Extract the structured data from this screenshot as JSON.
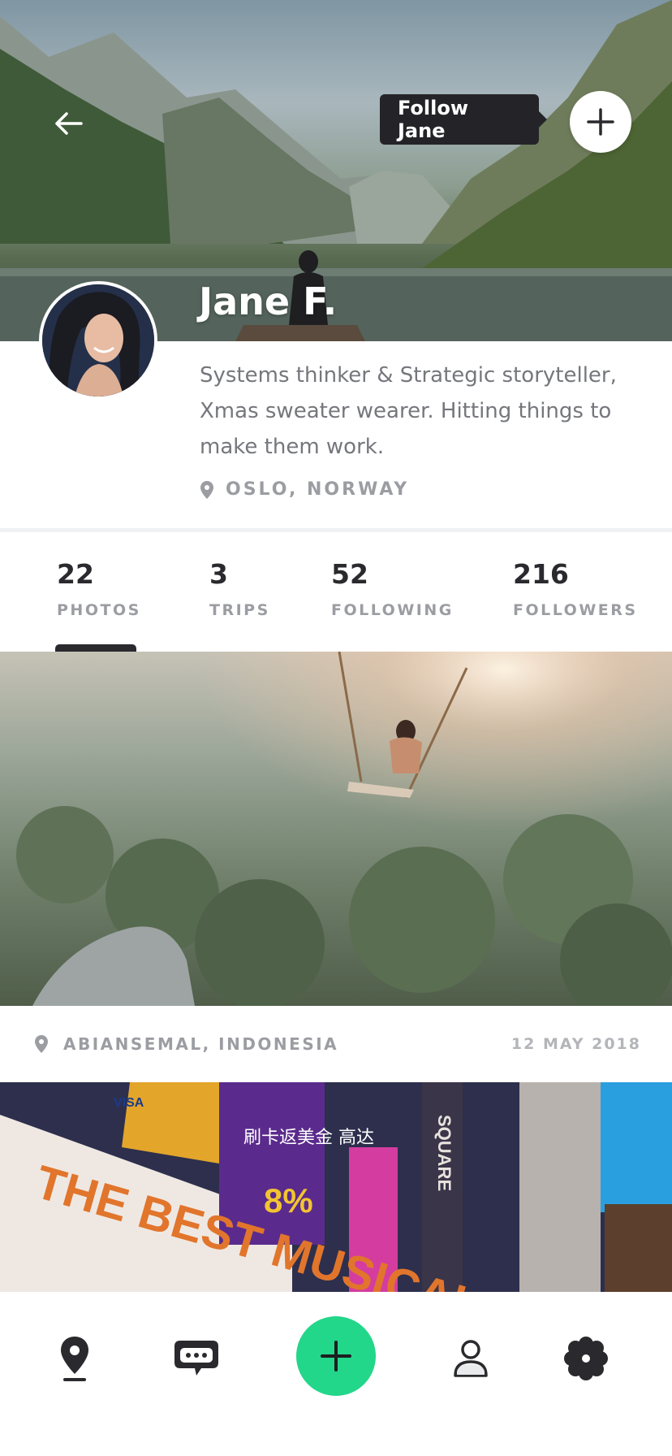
{
  "header": {
    "follow_tooltip": "Follow Jane",
    "back_icon": "arrow-left-icon",
    "follow_icon": "plus-icon"
  },
  "profile": {
    "name": "Jane F.",
    "bio": "Systems thinker & Strategic storyteller, Xmas sweater wearer. Hitting things to make them work.",
    "location": "OSLO, NORWAY"
  },
  "stats": [
    {
      "value": "22",
      "label": "PHOTOS"
    },
    {
      "value": "3",
      "label": "TRIPS"
    },
    {
      "value": "52",
      "label": "FOLLOWING"
    },
    {
      "value": "216",
      "label": "FOLLOWERS"
    }
  ],
  "active_stat": "PHOTOS",
  "feed": [
    {
      "location": "ABIANSEMAL, INDONESIA",
      "date": "12 MAY 2018"
    }
  ],
  "photo2_signs": {
    "billboard": "THE BEST MUSICAL OF THIS",
    "percent": "8%",
    "chinese": "刷卡返美金 高达",
    "brand": "VISA",
    "vertical": "SQUARE"
  },
  "tabbar": {
    "items": [
      "map-pin-icon",
      "chat-icon",
      "add-icon",
      "user-icon",
      "settings-flower-icon"
    ],
    "accent": "#22d68a"
  }
}
